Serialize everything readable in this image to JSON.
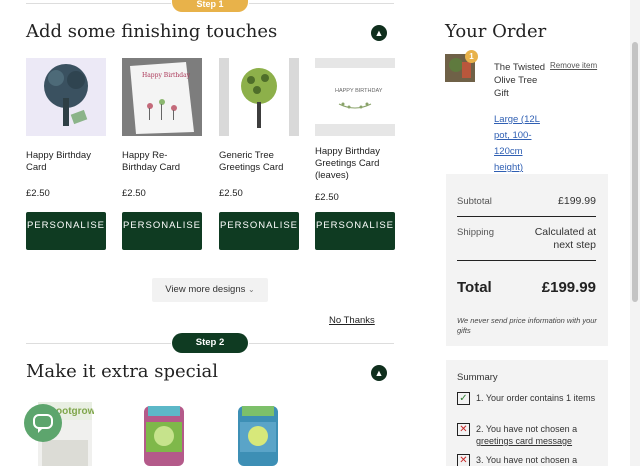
{
  "steps": {
    "step1_label": "Step 1",
    "step2_label": "Step 2"
  },
  "finishing": {
    "title": "Add some finishing touches",
    "cards": [
      {
        "name": "Happy Birthday Card",
        "price": "£2.50",
        "button": "PERSONALISE"
      },
      {
        "name": "Happy Re-Birthday Card",
        "price": "£2.50",
        "button": "PERSONALISE"
      },
      {
        "name": "Generic Tree Greetings Card",
        "price": "£2.50",
        "button": "PERSONALISE"
      },
      {
        "name": "Happy Birthday Greetings Card (leaves)",
        "price": "£2.50",
        "button": "PERSONALISE"
      }
    ],
    "card2_art_text": "Happy Birthday",
    "card4_art_text": "HAPPY BIRTHDAY",
    "view_more": "View more designs",
    "no_thanks": "No Thanks"
  },
  "extra": {
    "title": "Make it extra special",
    "product1_brand": "ootgrow"
  },
  "order": {
    "title": "Your Order",
    "badge": "1",
    "item_name": "The Twisted Olive Tree Gift",
    "item_variant": "Large (12L pot, 100-120cm height)",
    "remove": "Remove item",
    "subtotal_label": "Subtotal",
    "subtotal_value": "£199.99",
    "shipping_label": "Shipping",
    "shipping_value": "Calculated at next step",
    "total_label": "Total",
    "total_value": "£199.99",
    "note": "We never send price information with your gifts"
  },
  "summary": {
    "title": "Summary",
    "item1": "1. Your order contains 1 items",
    "item2_prefix": "2. You have not chosen a",
    "item2_link": "greetings card message",
    "item3": "3. You have not chosen a"
  },
  "colors": {
    "accent": "#e8b24a",
    "primary": "#0f3b22",
    "link": "#2f5fb3"
  }
}
